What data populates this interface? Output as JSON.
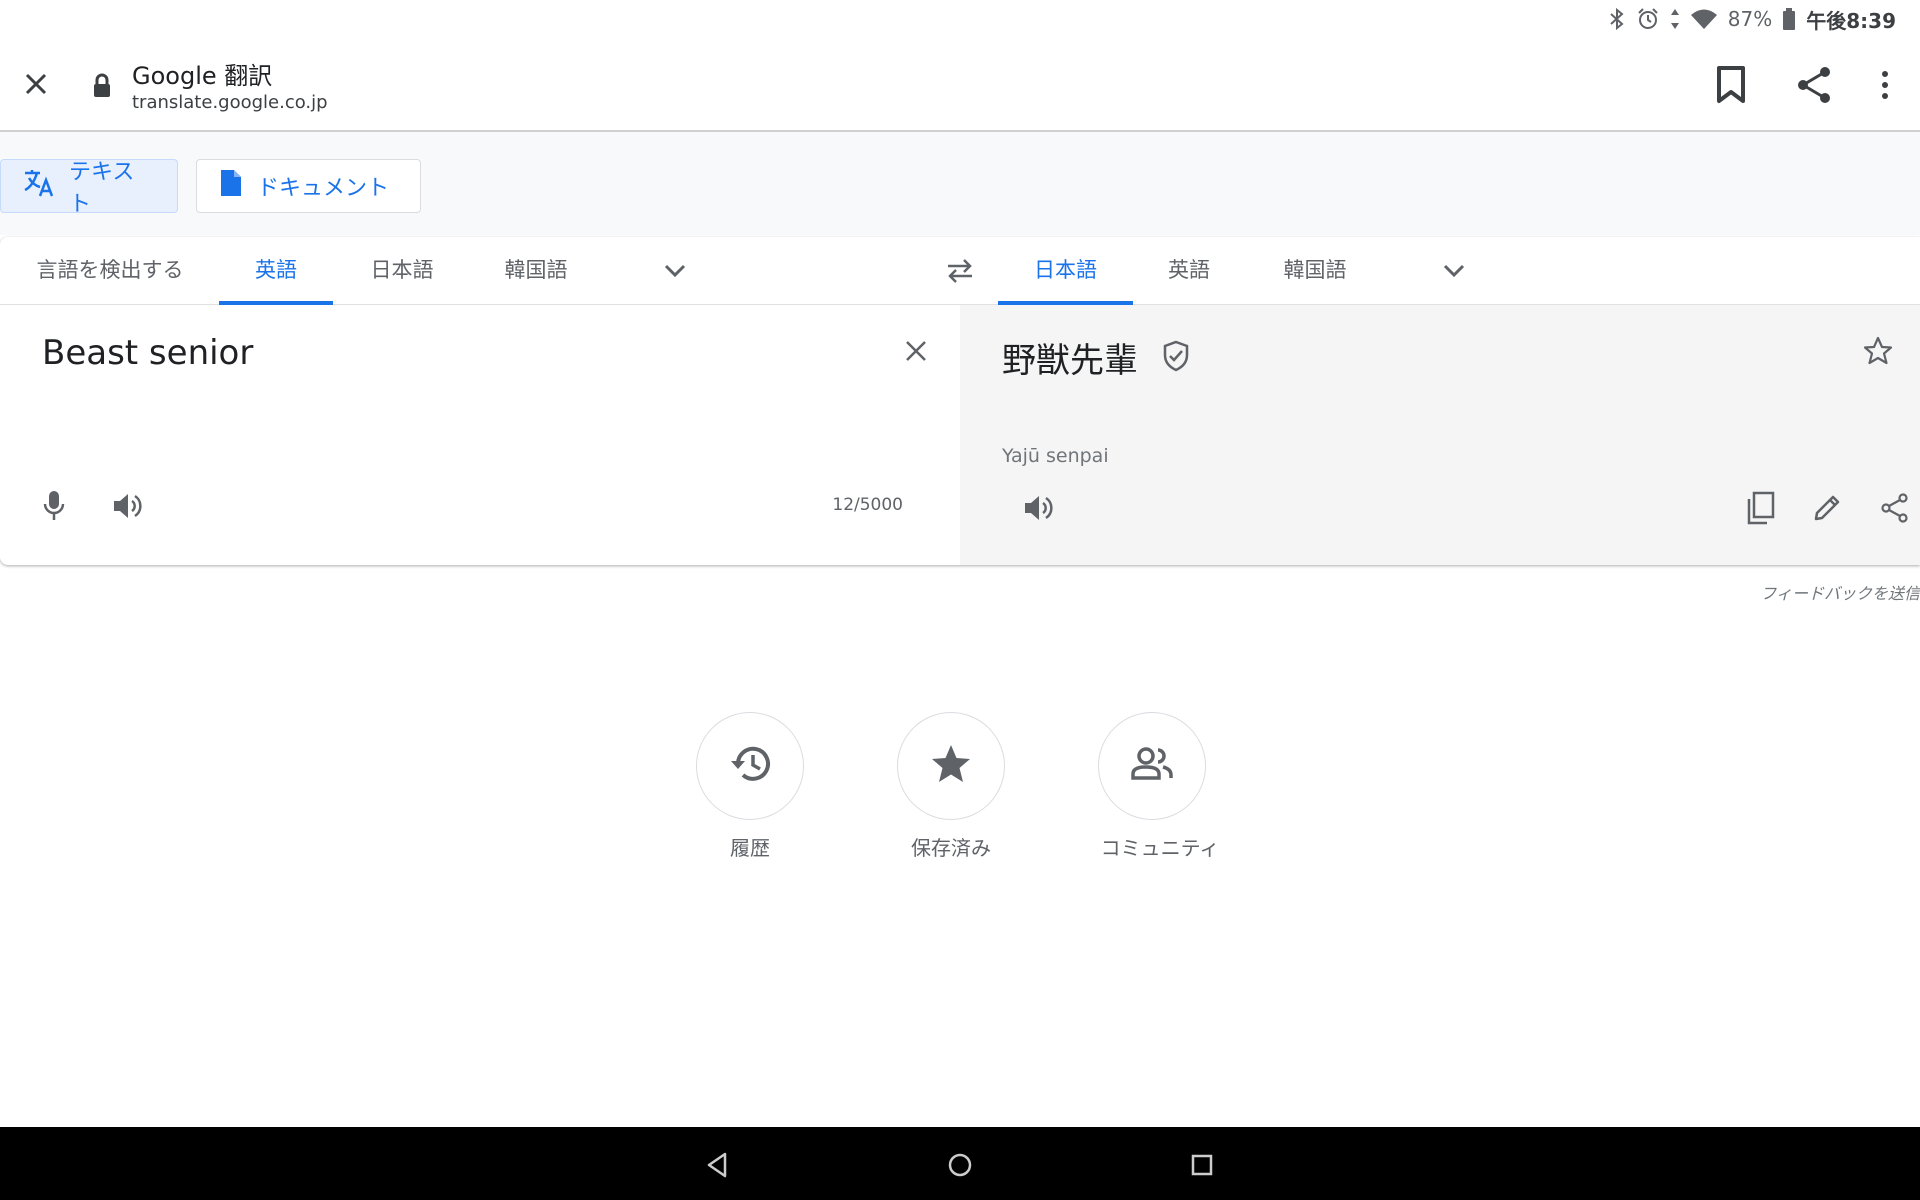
{
  "status_bar": {
    "battery": "87%",
    "time": "午後8:39",
    "icons": [
      "bluetooth-icon",
      "alarm-icon",
      "data-arrows-icon",
      "wifi-icon",
      "battery-icon"
    ]
  },
  "browser": {
    "title": "Google 翻訳",
    "url": "translate.google.co.jp",
    "icons": [
      "close-icon",
      "lock-icon",
      "bookmark-icon",
      "share-icon",
      "more-vert-icon"
    ]
  },
  "modes": {
    "text_label": "テキスト",
    "document_label": "ドキュメント",
    "active": "text"
  },
  "source_languages": {
    "detect": "言語を検出する",
    "items": [
      "英語",
      "日本語",
      "韓国語"
    ],
    "selected": "英語"
  },
  "target_languages": {
    "items": [
      "日本語",
      "英語",
      "韓国語"
    ],
    "selected": "日本語"
  },
  "source": {
    "text": "Beast senior",
    "char_count": "12/5000"
  },
  "target": {
    "text": "野獣先輩",
    "transliteration": "Yajū senpai"
  },
  "feedback_label": "フィードバックを送信",
  "shortcuts": {
    "history": "履歴",
    "saved": "保存済み",
    "community": "コミュニティ"
  },
  "colors": {
    "accent": "#1a73e8",
    "icon_grey": "#5f6368",
    "target_bg": "#f5f5f5",
    "nav_bg": "#000000"
  }
}
